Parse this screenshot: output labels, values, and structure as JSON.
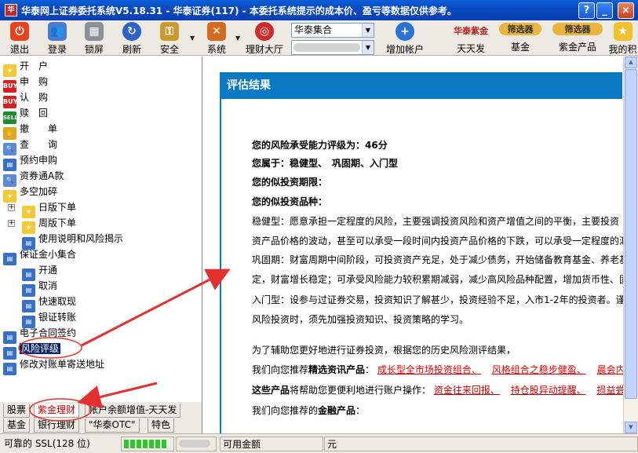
{
  "window": {
    "title": "华泰网上证券委托系统V5.18.31 - 华泰证券(117) - 本委托系统提示的成本价、盈亏等数据仅供参考。",
    "buttons": [
      "?",
      "_",
      "□",
      "×"
    ]
  },
  "toolbar": {
    "buttons": [
      {
        "label": "退出",
        "icon": "power-icon",
        "color": "#e8431e"
      },
      {
        "label": "登录",
        "icon": "users-icon",
        "color": "#4b7bd0"
      },
      {
        "label": "锁屏",
        "icon": "lock-icon",
        "color": "#8a8f99"
      },
      {
        "label": "刷新",
        "icon": "refresh-icon",
        "color": "#2d63c8"
      },
      {
        "label": "安全",
        "icon": "key-icon",
        "color": "#c99a2e"
      },
      {
        "label": "系统",
        "icon": "tools-icon",
        "color": "#d26a1f"
      },
      {
        "label": "理财大厅",
        "icon": "target-icon",
        "color": "#d22a2a"
      }
    ],
    "account_select": {
      "value": "华泰集合"
    },
    "add_account": "增加帐户",
    "promos": [
      {
        "top": "华泰紫金",
        "label": "天天发"
      },
      {
        "top": "筛选器",
        "label": "基金"
      },
      {
        "top": "筛选器",
        "label": "紫金产品"
      },
      {
        "top": "",
        "label": "我的积"
      }
    ]
  },
  "tree": {
    "items": [
      {
        "label": "开　户",
        "icon": "star-doc-icon",
        "tag": ""
      },
      {
        "label": "申　购",
        "icon": "buy-icon",
        "tag": "BUY"
      },
      {
        "label": "认　购",
        "icon": "buy-icon",
        "tag": "BUY"
      },
      {
        "label": "赎　回",
        "icon": "sell-icon",
        "tag": "SELL"
      },
      {
        "label": "撤　　单",
        "icon": "hand-icon",
        "tag": ""
      },
      {
        "label": "查　　询",
        "icon": "magnifier-icon",
        "tag": ""
      },
      {
        "label": "预约申购",
        "icon": "doc-icon",
        "tag": ""
      },
      {
        "label": "资券通A款",
        "icon": "magnifier-icon",
        "tag": ""
      },
      {
        "label": "多空加碎",
        "icon": "star-doc-icon",
        "tag": ""
      },
      {
        "label": "日版下单",
        "icon": "star-doc-icon",
        "tag": ""
      },
      {
        "label": "周版下单",
        "icon": "star-doc-icon",
        "tag": ""
      },
      {
        "label": "使用说明和风险揭示",
        "icon": "doc-icon",
        "tag": ""
      },
      {
        "label": "保证金小集合",
        "icon": "doc-icon",
        "tag": ""
      },
      {
        "label": "开通",
        "icon": "doc-icon",
        "tag": ""
      },
      {
        "label": "取消",
        "icon": "doc-icon",
        "tag": ""
      },
      {
        "label": "快速取现",
        "icon": "doc-icon",
        "tag": ""
      },
      {
        "label": "银证转账",
        "icon": "doc-icon",
        "tag": ""
      },
      {
        "label": "电子合同签约",
        "icon": "doc-icon",
        "tag": ""
      },
      {
        "label": "风险评级",
        "icon": "doc-icon",
        "tag": ""
      },
      {
        "label": "修改对账单寄送地址",
        "icon": "doc-icon",
        "tag": ""
      }
    ],
    "expanders": [
      "+",
      "+"
    ]
  },
  "tabs": {
    "row1": [
      "股票",
      "紫金理财",
      "帐户余额增值-天天发"
    ],
    "row2": [
      "基金",
      "银行理财",
      "\"华泰OTC\"",
      "特色"
    ]
  },
  "content": {
    "heading": "评估结果",
    "rating_label": "您的风险承受能力评级为：",
    "rating_value": "46分",
    "category_label": "您属于：",
    "category_value": "稳健型、　巩固期、入门型",
    "period_label": "您的似投资期限：",
    "variety_label": "您的似投资品种：",
    "para1": "稳健型：愿意承担一定程度的风险，主要强调投资风险和资产增值之间的平衡，主要投资",
    "para2": "资产品价格的波动，甚至可以承受一段时间内投资产品价格的下跌，可以承受一定程度的汇",
    "para3": "巩固期：财富周期中间阶段，可投资资产充足，处于减少债务，开始储备教育基金、养老基",
    "para4": "定，财富增长稳定；可承受风险能力较积累期减弱，减少高风险品种配置，增加货币性、固",
    "para5": "入门型：设参与过证券交易，投资知识了解甚少，投资经验不足，入市1-2年的投资者。谨",
    "para6": "风险投资时，须先加强投资知识、投资策略的学习。",
    "help_line": "为了辅助您更好地进行证券投资，根据您的历史风险测评结果，",
    "rec_info_prefix": "我们向您推荐",
    "rec_info_bold": "精选资讯产品",
    "rec_info_colon": "：",
    "rec_info_links": [
      "成长型全市场投资组合、",
      "风格组合之稳步健盈、",
      "晨会内参"
    ],
    "tools_bold": "这些产品",
    "tools_text": "将帮助您更便利地进行账户操作：",
    "tools_links": [
      "资金往来回报、",
      "持仓股异动提醒、",
      "损益尝警"
    ],
    "fin_prefix": "我们向您推荐的",
    "fin_bold": "金融产品",
    "fin_colon": "："
  },
  "status": {
    "ssl": "可靠的 SSL(128 位)",
    "available": "可用金额",
    "unit": "元"
  }
}
